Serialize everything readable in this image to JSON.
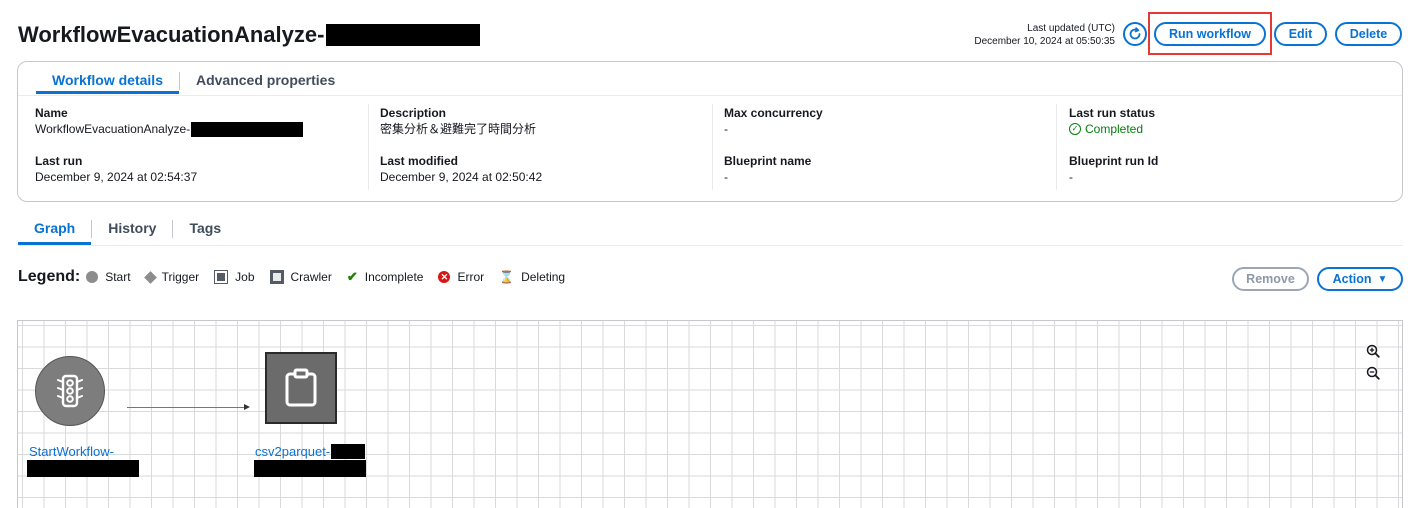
{
  "header": {
    "title": "WorkflowEvacuationAnalyze-",
    "last_updated_label": "Last updated (UTC)",
    "last_updated_value": "December 10, 2024 at 05:50:35",
    "buttons": {
      "run_workflow": "Run workflow",
      "edit": "Edit",
      "delete": "Delete"
    },
    "highlight_color": "#e53935"
  },
  "details": {
    "tabs": [
      "Workflow details",
      "Advanced properties"
    ],
    "active_tab": "Workflow details",
    "fields": {
      "name": {
        "label": "Name",
        "value": "WorkflowEvacuationAnalyze-"
      },
      "description": {
        "label": "Description",
        "value": "密集分析＆避難完了時間分析"
      },
      "max_concurrency": {
        "label": "Max concurrency",
        "value": "-"
      },
      "last_run_status": {
        "label": "Last run status",
        "value": "Completed"
      },
      "last_run": {
        "label": "Last run",
        "value": "December 9, 2024 at 02:54:37"
      },
      "last_modified": {
        "label": "Last modified",
        "value": "December 9, 2024 at 02:50:42"
      },
      "blueprint_name": {
        "label": "Blueprint name",
        "value": "-"
      },
      "blueprint_run_id": {
        "label": "Blueprint run Id",
        "value": "-"
      }
    }
  },
  "graph_tabs": [
    "Graph",
    "History",
    "Tags"
  ],
  "legend": {
    "title": "Legend:",
    "items": [
      "Start",
      "Trigger",
      "Job",
      "Crawler",
      "Incomplete",
      "Error",
      "Deleting"
    ]
  },
  "graph_actions": {
    "remove": "Remove",
    "action": "Action"
  },
  "graph": {
    "nodes": [
      {
        "type": "trigger",
        "label": "StartWorkflow-",
        "icon": "traffic-light-icon"
      },
      {
        "type": "job",
        "label": "csv2parquet-",
        "icon": "clipboard-icon"
      }
    ]
  },
  "colors": {
    "accent": "#0972d3",
    "success": "#037f0c",
    "error": "#d91515",
    "border": "#c6c6cd"
  }
}
